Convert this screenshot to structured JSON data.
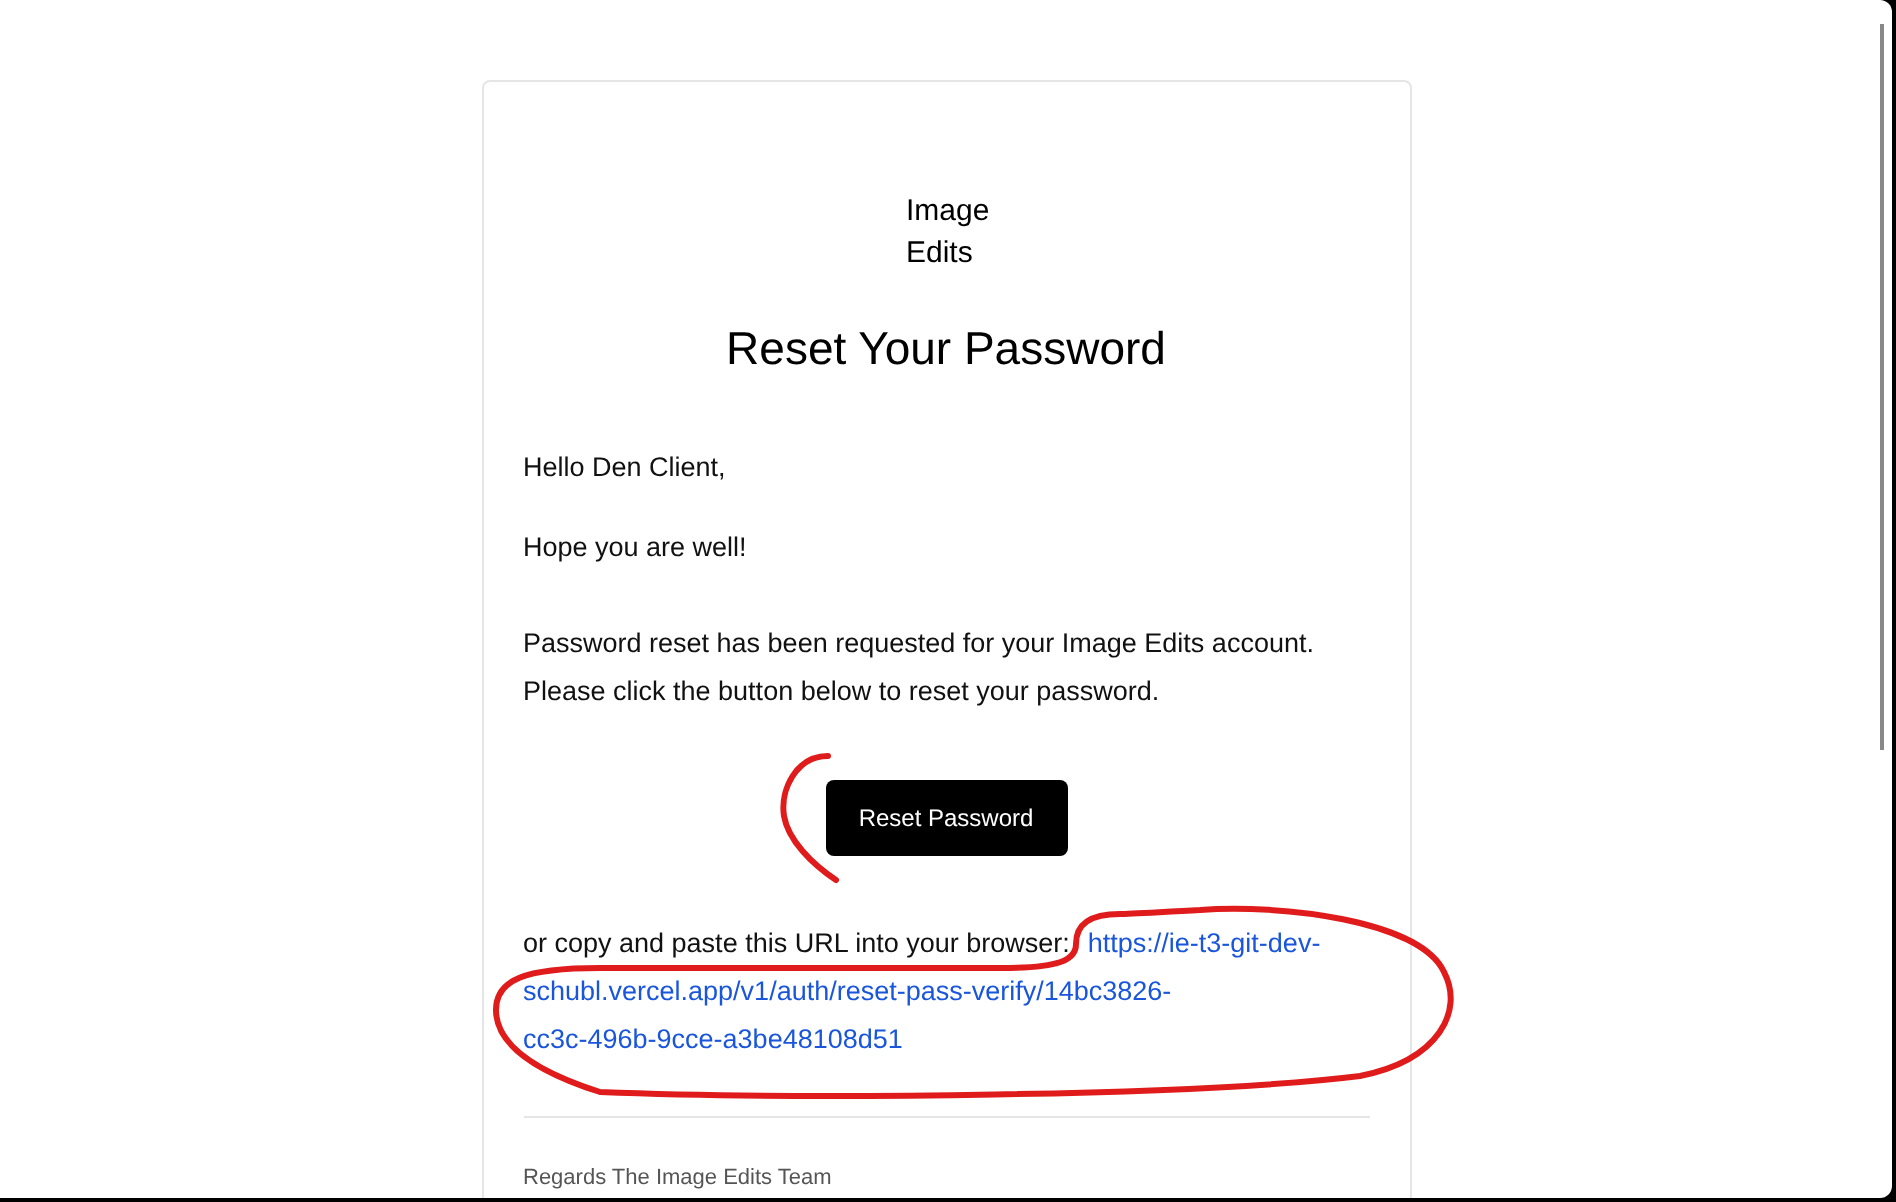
{
  "email": {
    "logo": "Image Edits",
    "title": "Reset Your Password",
    "greeting": "Hello Den Client,",
    "wish": "Hope you are well!",
    "body": [
      "Password reset has been requested for your Image Edits account.",
      "Please click the button below to reset your password."
    ],
    "button": "Reset Password",
    "copy_text": "or copy and paste this URL into your browser:",
    "url_lines": [
      "https://ie-t3-git-dev-",
      "schubl.vercel.app/v1/auth/reset-pass-verify/14bc3826-",
      "cc3c-496b-9cce-a3be48108d51"
    ],
    "signature": "Regards The Image Edits Team"
  }
}
